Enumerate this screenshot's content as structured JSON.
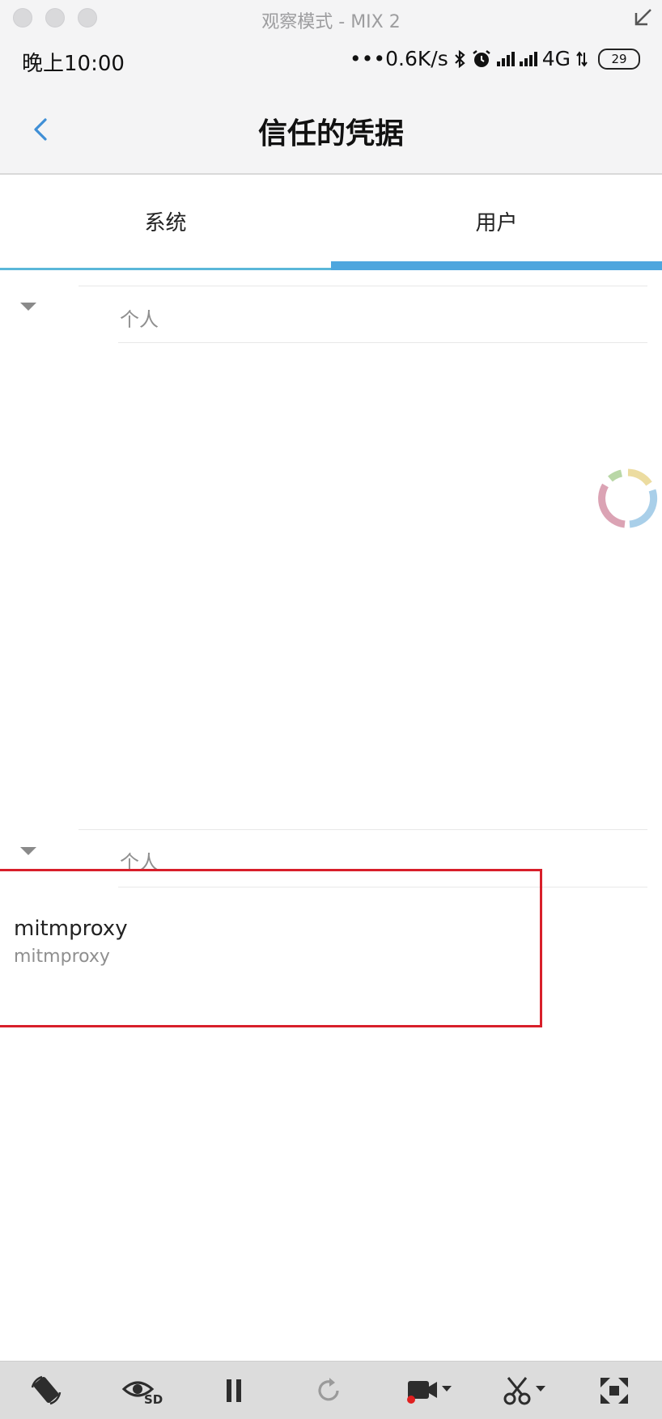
{
  "window": {
    "title": "观察模式 - MIX 2"
  },
  "status_bar": {
    "time": "晚上10:00",
    "speed": "•••0.6K/s",
    "network": "4G",
    "battery": "29"
  },
  "app_bar": {
    "title": "信任的凭据",
    "back_icon": "chevron-left-icon"
  },
  "tabs": [
    {
      "label": "系统",
      "selected": false
    },
    {
      "label": "用户",
      "selected": true
    }
  ],
  "sections": [
    {
      "label": "个人"
    },
    {
      "label": "个人"
    }
  ],
  "certificate": {
    "name": "mitmproxy",
    "issuer": "mitmproxy"
  },
  "colors": {
    "accent": "#4ea6de",
    "highlight_border": "#d81f2a"
  },
  "toolbar": {
    "icons": [
      "rotate-screen-icon",
      "quality-sd-icon",
      "pause-icon",
      "refresh-icon",
      "record-video-icon",
      "screenshot-scissors-icon",
      "fullscreen-icon"
    ]
  }
}
